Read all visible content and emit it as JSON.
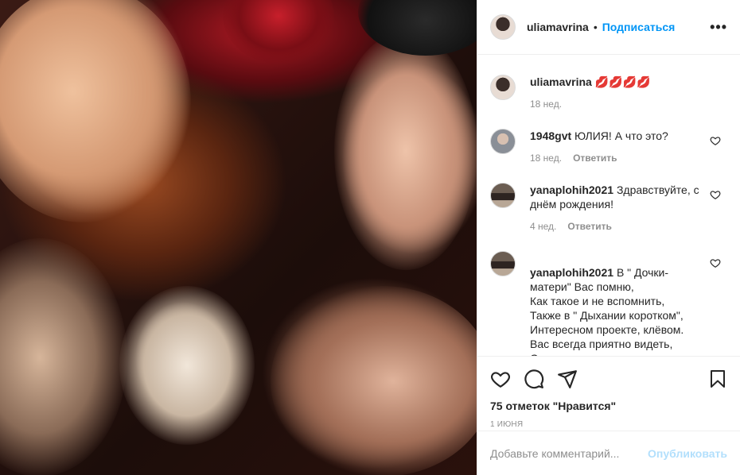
{
  "post": {
    "username": "uliamavrina",
    "follow_label": "Подписаться",
    "more_label": "•••"
  },
  "caption": {
    "username": "uliamavrina",
    "text": "💋💋💋💋",
    "time": "18 нед."
  },
  "comments": [
    {
      "username": "1948gvt",
      "text": "ЮЛИЯ! А что это?",
      "time": "18 нед.",
      "reply_label": "Ответить"
    },
    {
      "username": "yanaplohih2021",
      "text": "Здравствуйте, с днём рождения!",
      "time": "4 нед.",
      "reply_label": "Ответить"
    },
    {
      "username": "yanaplohih2021",
      "text": "В \" Дочки-матери\" Вас помню,\nКак такое и не вспомнить,\nТакже в \" Дыхании коротком\",\nИнтересном проекте, клёвом.\nВас всегда приятно видеть,\nОщущать, да также слышать,"
    }
  ],
  "likes": "75 отметок \"Нравится\"",
  "date": "1 июня",
  "add_comment": {
    "placeholder": "Добавьте комментарий...",
    "post_label": "Опубликовать"
  },
  "colors": {
    "accent": "#0095f6",
    "muted": "#8e8e8e",
    "post_disabled": "#b2dffc"
  }
}
